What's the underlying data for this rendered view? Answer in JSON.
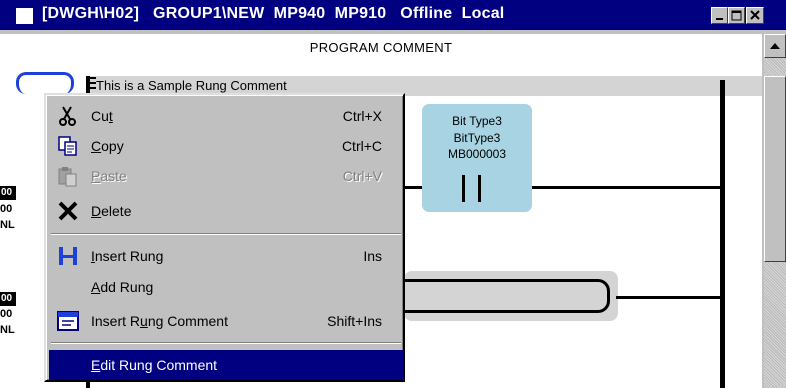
{
  "window": {
    "title": "[DWGH\\H02]   GROUP1\\NEW  MP940  MP910   Offline  Local"
  },
  "editor": {
    "program_comment": "PROGRAM COMMENT",
    "rung_comment": "This is a Sample Rung Comment",
    "contact": {
      "line1": "Bit Type3",
      "line2": "BitType3",
      "line3": "MB000003"
    },
    "rung1": {
      "num": "00",
      "line2": "00",
      "line3": "NL"
    },
    "rung2": {
      "num": "00",
      "line2": "00",
      "line3": "NL"
    }
  },
  "context_menu": {
    "items": [
      {
        "pre": "Cu",
        "ul": "t",
        "post": "",
        "shortcut": "Ctrl+X",
        "icon": "scissors-icon",
        "enabled": true
      },
      {
        "pre": "",
        "ul": "C",
        "post": "opy",
        "shortcut": "Ctrl+C",
        "icon": "copy-icon",
        "enabled": true
      },
      {
        "pre": "",
        "ul": "P",
        "post": "aste",
        "shortcut": "Ctrl+V",
        "icon": "paste-icon",
        "enabled": false
      },
      {
        "pre": "",
        "ul": "D",
        "post": "elete",
        "shortcut": "",
        "icon": "delete-x-icon",
        "enabled": true
      },
      {
        "pre": "",
        "ul": "I",
        "post": "nsert Rung",
        "shortcut": "Ins",
        "icon": "insert-rung-icon",
        "enabled": true
      },
      {
        "pre": "",
        "ul": "A",
        "post": "dd Rung",
        "shortcut": "",
        "icon": "",
        "enabled": true
      },
      {
        "pre": "Insert R",
        "ul": "u",
        "post": "ng Comment",
        "shortcut": "Shift+Ins",
        "icon": "insert-comment-icon",
        "enabled": true
      },
      {
        "pre": "",
        "ul": "E",
        "post": "dit Rung Comment",
        "shortcut": "",
        "icon": "",
        "enabled": true,
        "selected": true
      }
    ]
  },
  "colors": {
    "titlebar": "#000080",
    "selection": "#000080",
    "contact_highlight": "#a7d3e3",
    "rung_select": "#1e3fd8"
  }
}
